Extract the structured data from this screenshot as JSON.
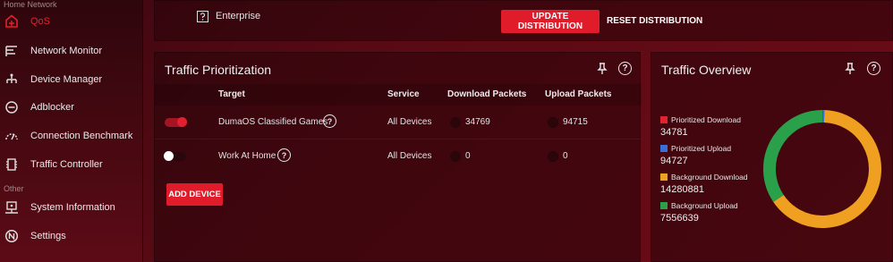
{
  "sidebar": {
    "section_home": "Home Network",
    "section_other": "Other",
    "items": [
      {
        "label": "QoS",
        "icon": "qos-icon"
      },
      {
        "label": "Network Monitor",
        "icon": "network-monitor-icon"
      },
      {
        "label": "Device Manager",
        "icon": "device-manager-icon"
      },
      {
        "label": "Adblocker",
        "icon": "adblocker-icon"
      },
      {
        "label": "Connection Benchmark",
        "icon": "benchmark-gauge-icon"
      },
      {
        "label": "Traffic Controller",
        "icon": "traffic-controller-icon"
      },
      {
        "label": "System Information",
        "icon": "system-information-icon"
      },
      {
        "label": "Settings",
        "icon": "settings-icon"
      }
    ]
  },
  "distribution": {
    "enterprise_label": "Enterprise",
    "update_label": "UPDATE DISTRIBUTION",
    "reset_label": "RESET DISTRIBUTION"
  },
  "traffic_prioritization": {
    "title": "Traffic Prioritization",
    "columns": [
      "Target",
      "Service",
      "Download Packets",
      "Upload Packets"
    ],
    "rows": [
      {
        "enabled": true,
        "target": "DumaOS Classified Games",
        "service": "All Devices",
        "download": "34769",
        "upload": "94715"
      },
      {
        "enabled": false,
        "target": "Work At Home",
        "service": "All Devices",
        "download": "0",
        "upload": "0"
      }
    ],
    "add_label": "ADD DEVICE"
  },
  "traffic_overview": {
    "title": "Traffic Overview",
    "legend": [
      {
        "name": "Prioritized Download",
        "value": "34781",
        "color": "#e0232e"
      },
      {
        "name": "Prioritized Upload",
        "value": "94727",
        "color": "#3a6fd8"
      },
      {
        "name": "Background Download",
        "value": "14280881",
        "color": "#f0a020"
      },
      {
        "name": "Background Upload",
        "value": "7556639",
        "color": "#2aa04a"
      }
    ]
  },
  "chart_data": {
    "type": "pie",
    "categories": [
      "Prioritized Download",
      "Prioritized Upload",
      "Background Download",
      "Background Upload"
    ],
    "values": [
      34781,
      94727,
      14280881,
      7556639
    ],
    "colors": [
      "#e0232e",
      "#3a6fd8",
      "#f0a020",
      "#2aa04a"
    ],
    "donut": true
  },
  "icons": {
    "pin": "pin-icon",
    "help": "help-icon",
    "enterprise": "enterprise-help-icon"
  },
  "colors": {
    "accent": "#e01b2a",
    "background": "#5a0a14"
  }
}
